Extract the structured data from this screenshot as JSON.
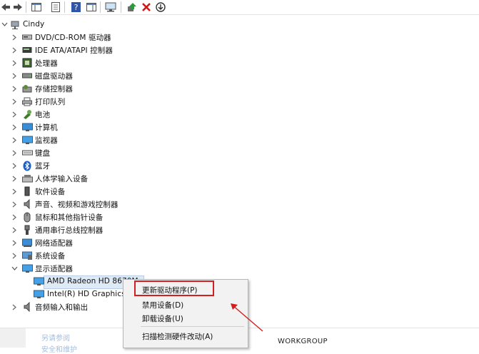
{
  "toolbar": {
    "buttons": [
      {
        "icon": "back-arrow-icon"
      },
      {
        "icon": "forward-arrow-icon"
      },
      {
        "icon": "show-hide-console-tree-icon"
      },
      {
        "icon": "properties-icon"
      },
      {
        "icon": "help-icon"
      },
      {
        "icon": "action-pane-icon"
      },
      {
        "icon": "scan-hardware-monitor-icon"
      },
      {
        "icon": "update-driver-icon"
      },
      {
        "icon": "uninstall-red-x-icon"
      },
      {
        "icon": "disable-device-icon"
      }
    ]
  },
  "tree": {
    "root": "Cindy",
    "categories": [
      {
        "label": "DVD/CD-ROM 驱动器",
        "icon": "dvd-drive-icon"
      },
      {
        "label": "IDE ATA/ATAPI 控制器",
        "icon": "ide-controller-icon"
      },
      {
        "label": "处理器",
        "icon": "processor-icon"
      },
      {
        "label": "磁盘驱动器",
        "icon": "disk-drive-icon"
      },
      {
        "label": "存储控制器",
        "icon": "storage-controller-icon"
      },
      {
        "label": "打印队列",
        "icon": "printer-icon"
      },
      {
        "label": "电池",
        "icon": "battery-icon"
      },
      {
        "label": "计算机",
        "icon": "computer-icon"
      },
      {
        "label": "监视器",
        "icon": "monitor-icon"
      },
      {
        "label": "键盘",
        "icon": "keyboard-icon"
      },
      {
        "label": "蓝牙",
        "icon": "bluetooth-icon"
      },
      {
        "label": "人体学输入设备",
        "icon": "hid-icon"
      },
      {
        "label": "软件设备",
        "icon": "software-device-icon"
      },
      {
        "label": "声音、视频和游戏控制器",
        "icon": "speaker-icon"
      },
      {
        "label": "鼠标和其他指针设备",
        "icon": "mouse-icon"
      },
      {
        "label": "通用串行总线控制器",
        "icon": "usb-icon"
      },
      {
        "label": "网络适配器",
        "icon": "network-adapter-icon"
      },
      {
        "label": "系统设备",
        "icon": "system-device-icon"
      },
      {
        "label": "显示适配器",
        "icon": "display-adapter-icon"
      }
    ],
    "display_children": [
      {
        "label": "AMD Radeon HD 8670M"
      },
      {
        "label": "Intel(R) HD Graphics"
      }
    ],
    "last_category": {
      "label": "音频输入和输出",
      "icon": "audio-io-icon"
    }
  },
  "context_menu": {
    "items": [
      "更新驱动程序(P)",
      "禁用设备(D)",
      "卸载设备(U)",
      "扫描检测硬件改动(A)"
    ]
  },
  "background": {
    "partial_link_1": "另请参阅",
    "partial_link_2": "安全和维护",
    "workgroup": "WORKGROUP"
  },
  "colors": {
    "highlight_box": "#d21f1f",
    "selection": "#dfeaf7",
    "menu_bg": "#f2f2f2"
  }
}
